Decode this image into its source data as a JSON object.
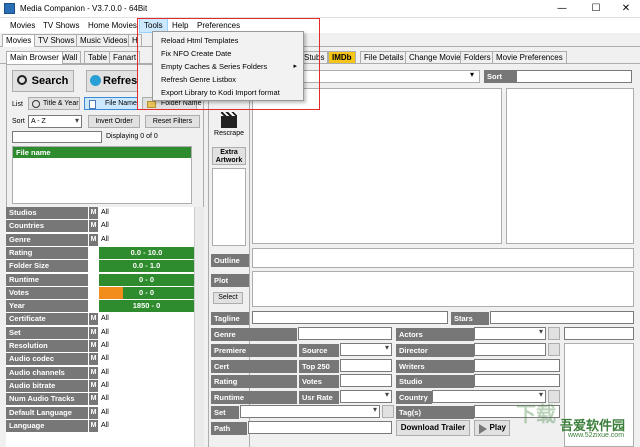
{
  "window": {
    "title": "Media Companion - V3.7.0.0 - 64Bit",
    "min": "—",
    "max": "☐",
    "close": "✕"
  },
  "menu": [
    "Movies",
    "TV Shows",
    "Home Movies",
    "Tools",
    "Help",
    "Preferences"
  ],
  "tools_menu": [
    "Reload Html Templates",
    "Fix NFO Create Date",
    "Empty Caches & Series Folders",
    "Refresh Genre Listbox",
    "Export Library to Kodi Import format"
  ],
  "main_tabs": [
    "Movies",
    "TV Shows",
    "Music Videos",
    "H"
  ],
  "sub_tabs_left": [
    "Main Browser",
    "Wall",
    "Table",
    "Fanart"
  ],
  "sub_tabs_right": [
    "Stubs",
    "IMDb",
    "File Details",
    "Change Movie",
    "Folders",
    "Movie Preferences"
  ],
  "browser": {
    "search_label": "Search",
    "refresh_label": "Refresh",
    "list_label": "List",
    "list_options": [
      "Title & Year",
      "File Name",
      "Folder Name"
    ],
    "sort_label": "Sort",
    "sort_value": "A - Z",
    "invert_order": "Invert Order",
    "reset_filters": "Reset Filters",
    "displaying": "Displaying 0 of 0",
    "file_name_header": "File name"
  },
  "filters": [
    {
      "label": "Studios",
      "m": "M",
      "value": "All",
      "type": "text"
    },
    {
      "label": "Countries",
      "m": "M",
      "value": "All",
      "type": "text"
    },
    {
      "label": "Genre",
      "m": "M",
      "value": "All",
      "type": "text"
    },
    {
      "label": "Rating",
      "value": "0.0 - 10.0",
      "type": "range"
    },
    {
      "label": "Folder Size",
      "value": "0.0 - 1.0",
      "type": "range"
    },
    {
      "label": "Runtime",
      "value": "0 - 0",
      "type": "range"
    },
    {
      "label": "Votes",
      "value": "0 - 0",
      "type": "votes"
    },
    {
      "label": "Year",
      "value": "1850 - 0",
      "type": "range"
    },
    {
      "label": "Certificate",
      "m": "M",
      "value": "All",
      "type": "text"
    },
    {
      "label": "Set",
      "m": "M",
      "value": "All",
      "type": "text"
    },
    {
      "label": "Resolution",
      "m": "M",
      "value": "All",
      "type": "text"
    },
    {
      "label": "Audio codec",
      "m": "M",
      "value": "All",
      "type": "text"
    },
    {
      "label": "Audio channels",
      "m": "M",
      "value": "All",
      "type": "text"
    },
    {
      "label": "Audio bitrate",
      "m": "M",
      "value": "All",
      "type": "text"
    },
    {
      "label": "Num Audio Tracks",
      "m": "M",
      "value": "All",
      "type": "text"
    },
    {
      "label": "Default Language",
      "m": "M",
      "value": "All",
      "type": "text"
    },
    {
      "label": "Language",
      "m": "M",
      "value": "All",
      "type": "text"
    }
  ],
  "tools": {
    "rescrape": "Rescrape",
    "extra_artwork": "Extra Artwork",
    "sort_label": "Sort"
  },
  "details": {
    "outline": "Outline",
    "plot": "Plot",
    "select": "Select",
    "tagline": "Tagline",
    "stars": "Stars",
    "genre": "Genre",
    "actors": "Actors",
    "premiere": "Premiere",
    "source": "Source",
    "director": "Director",
    "cert": "Cert",
    "top250": "Top 250",
    "writers": "Writers",
    "rating": "Rating",
    "votes": "Votes",
    "studio": "Studio",
    "runtime": "Runtime",
    "usr_rate": "Usr Rate",
    "country": "Country",
    "set": "Set",
    "tags": "Tag(s)",
    "path": "Path",
    "download_trailer": "Download Trailer",
    "play": "Play"
  },
  "watermark": {
    "line1": "吾爱软件园",
    "line2": "www.52zixue.com",
    "line3": "下载"
  }
}
